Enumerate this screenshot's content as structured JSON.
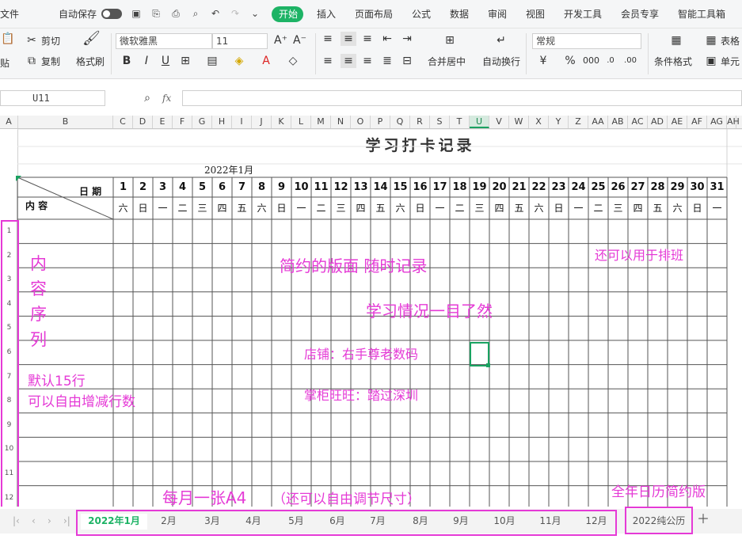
{
  "menubar": {
    "file": "文件",
    "autosave": "自动保存",
    "tabs": [
      "开始",
      "插入",
      "页面布局",
      "公式",
      "数据",
      "审阅",
      "视图",
      "开发工具",
      "会员专享",
      "智能工具箱"
    ]
  },
  "ribbon": {
    "cut": "剪切",
    "copy": "复制",
    "paste": "贴",
    "format_painter": "格式刷",
    "font_name": "微软雅黑",
    "font_size": "11",
    "merge_center": "合并居中",
    "wrap_text": "自动换行",
    "number_format": "常规",
    "conditional_format": "条件格式",
    "table_style": "表格",
    "cell": "单元"
  },
  "formula_bar": {
    "name_box": "U11",
    "fx": "fx",
    "value": ""
  },
  "colors": {
    "accent_green": "#1db365",
    "annotation": "#e53ad6",
    "selected_cell": "#1aa261"
  },
  "columns": [
    "A",
    "B",
    "C",
    "D",
    "E",
    "F",
    "G",
    "H",
    "I",
    "J",
    "K",
    "L",
    "M",
    "N",
    "O",
    "P",
    "Q",
    "R",
    "S",
    "T",
    "U",
    "V",
    "W",
    "X",
    "Y",
    "Z",
    "AA",
    "AB",
    "AC",
    "AD",
    "AE",
    "AF",
    "AG",
    "AH"
  ],
  "sheet": {
    "title": "学习打卡记录",
    "month": "2022年1月",
    "header_date": "日 期",
    "header_content": "内 容",
    "days": [
      "1",
      "2",
      "3",
      "4",
      "5",
      "6",
      "7",
      "8",
      "9",
      "10",
      "11",
      "12",
      "13",
      "14",
      "15",
      "16",
      "17",
      "18",
      "19",
      "20",
      "21",
      "22",
      "23",
      "24",
      "25",
      "26",
      "27",
      "28",
      "29",
      "30",
      "31"
    ],
    "weekdays": [
      "六",
      "日",
      "一",
      "二",
      "三",
      "四",
      "五",
      "六",
      "日",
      "一",
      "二",
      "三",
      "四",
      "五",
      "六",
      "日",
      "一",
      "二",
      "三",
      "四",
      "五",
      "六",
      "日",
      "一",
      "二",
      "三",
      "四",
      "五",
      "六",
      "日",
      "一"
    ],
    "row_numbers": [
      "1",
      "2",
      "3",
      "4",
      "5",
      "6",
      "7",
      "8",
      "9",
      "10",
      "11",
      "12"
    ]
  },
  "annotations": {
    "content_seq": [
      "内",
      "容",
      "序",
      "列"
    ],
    "default_rows": "默认15行",
    "adjust_rows": "可以自由增减行数",
    "simple_layout": "简约的版面  随时记录",
    "scheduling": "还可以用于排班",
    "overview": "学习情况一目了然",
    "shop": "店铺：右手尊老数码",
    "keeper": "掌柜旺旺：踏过深圳",
    "per_month": "每月一张A4",
    "adjust_size": "（还可以自由调节尺寸）",
    "year_calendar": "全年日历简约版"
  },
  "sheet_tabs": [
    "2022年1月",
    "2月",
    "3月",
    "4月",
    "5月",
    "6月",
    "7月",
    "8月",
    "9月",
    "10月",
    "11月",
    "12月",
    "2022纯公历"
  ]
}
